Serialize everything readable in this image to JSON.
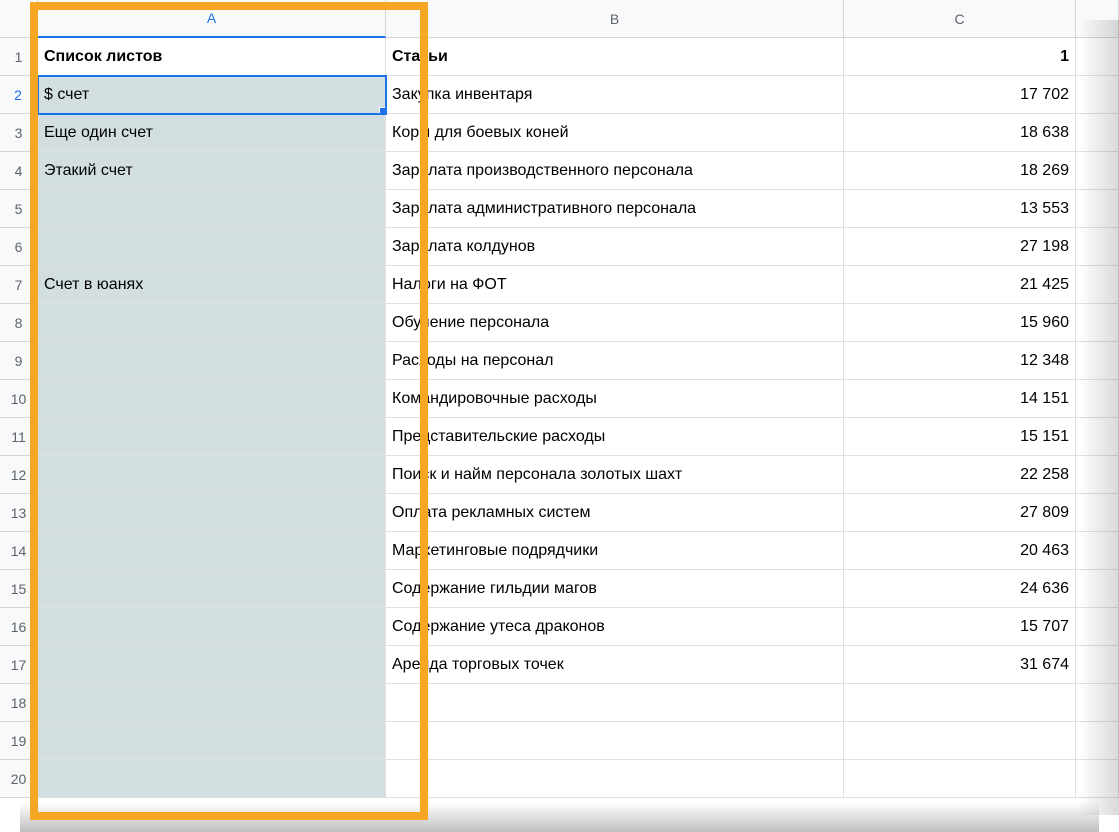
{
  "columns": [
    "A",
    "B",
    "C"
  ],
  "rowCount": 20,
  "activeCell": {
    "row": 2,
    "col": "A"
  },
  "header": {
    "A": "Список листов",
    "B": "Статьи",
    "C": "1"
  },
  "columnA": {
    "2": "$ счет",
    "3": "Еще один счет",
    "4": "Этакий счет",
    "7": "Счет в юанях"
  },
  "columnB": {
    "2": "Закупка инвентаря",
    "3": "Корм для боевых коней",
    "4": "Зарплата производственного персонала",
    "5": "Зарплата административного персонала",
    "6": "Зарплата колдунов",
    "7": "Налоги на ФОТ",
    "8": "Обучение персонала",
    "9": "Расходы на персонал",
    "10": "Командировочные расходы",
    "11": "Представительские расходы",
    "12": "Поиск и найм персонала золотых шахт",
    "13": "Оплата рекламных систем",
    "14": "Маркетинговые подрядчики",
    "15": "Содержание гильдии магов",
    "16": "Содержание утеса драконов",
    "17": "Аренда торговых точек"
  },
  "columnC": {
    "2": "17 702",
    "3": "18 638",
    "4": "18 269",
    "5": "13 553",
    "6": "27 198",
    "7": "21 425",
    "8": "15 960",
    "9": "12 348",
    "10": "14 151",
    "11": "15 151",
    "12": "22 258",
    "13": "27 809",
    "14": "20 463",
    "15": "24 636",
    "16": "15 707",
    "17": "31 674"
  }
}
